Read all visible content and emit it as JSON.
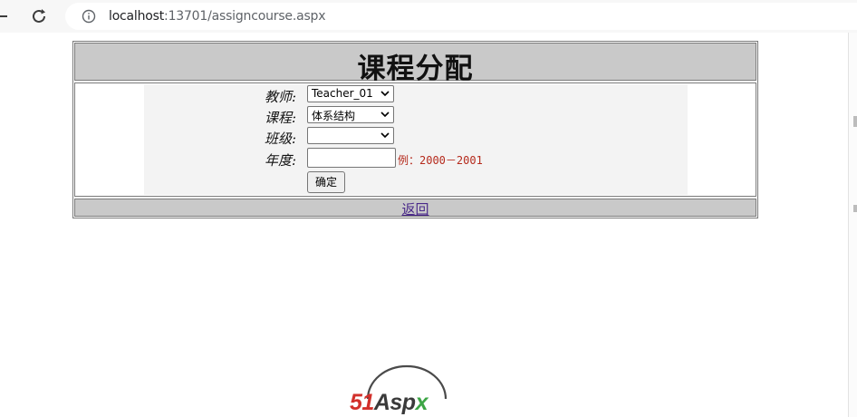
{
  "browser": {
    "url_host": "localhost",
    "url_rest": ":13701/assigncourse.aspx"
  },
  "page": {
    "title": "课程分配",
    "back_label": "返回"
  },
  "form": {
    "teacher_label": "教师:",
    "teacher_selected": "Teacher_01",
    "course_label": "课程:",
    "course_selected": "体系结构",
    "class_label": "班级:",
    "class_selected": "",
    "year_label": "年度:",
    "year_value": "",
    "year_hint": "例：2000－2001",
    "submit_label": "确定"
  },
  "logo": {
    "part1": "51",
    "part2": "A",
    "part3": "sp",
    "part4": "x",
    "colors": {
      "red": "#d2302b",
      "dark": "#3a3a3a",
      "green": "#3ca545"
    }
  },
  "colors": {
    "header_bg": "#c9c9c9",
    "panel_bg": "#f3f3f3",
    "hint_color": "#b52a1c",
    "link_color": "#4b2a8a"
  }
}
